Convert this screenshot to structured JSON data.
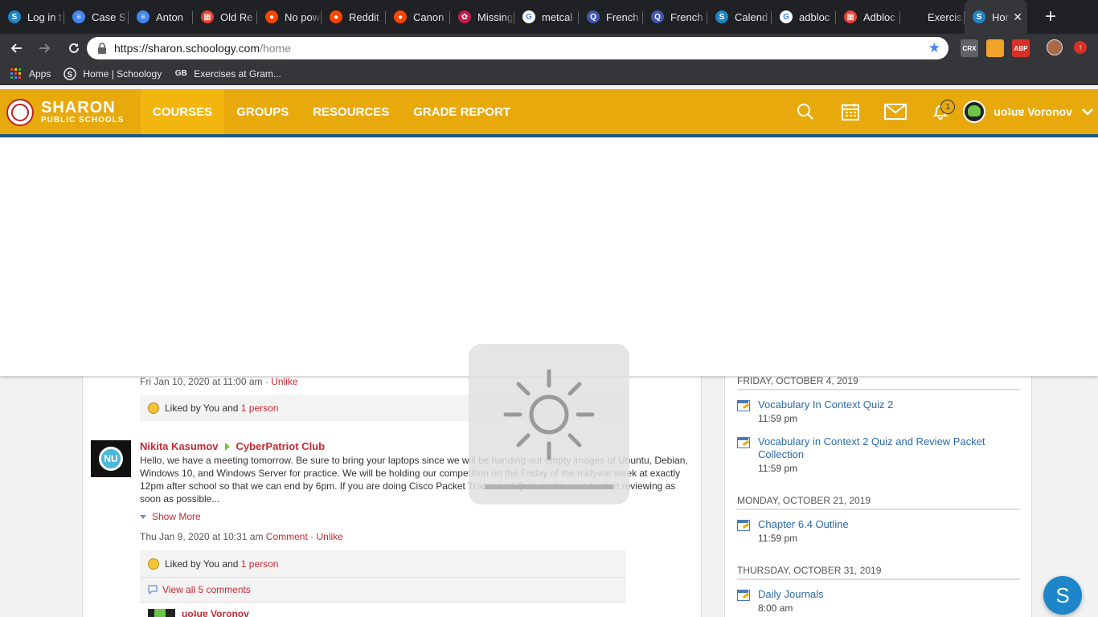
{
  "browser": {
    "tabs": [
      {
        "label": "Log in t",
        "icon": "schoology-icon",
        "color": "#1c86c8",
        "glyph": "S"
      },
      {
        "label": "Case S",
        "icon": "docs-icon",
        "color": "#4285f4",
        "glyph": "≡"
      },
      {
        "label": "Anton",
        "icon": "docs-icon",
        "color": "#4285f4",
        "glyph": "≡"
      },
      {
        "label": "Old Re",
        "icon": "store-icon",
        "color": "#e94235",
        "glyph": "▦"
      },
      {
        "label": "No pow",
        "icon": "reddit-icon",
        "color": "#ff4500",
        "glyph": "●"
      },
      {
        "label": "Reddit",
        "icon": "reddit-icon",
        "color": "#ff4500",
        "glyph": "●"
      },
      {
        "label": "Canon",
        "icon": "reddit-icon",
        "color": "#ff4500",
        "glyph": "●"
      },
      {
        "label": "Missing",
        "icon": "raspberry-icon",
        "color": "#c51a4a",
        "glyph": "✿"
      },
      {
        "label": "metcal",
        "icon": "google-icon",
        "color": "#ffffff",
        "glyph": "G"
      },
      {
        "label": "French",
        "icon": "quizlet-icon",
        "color": "#4257b2",
        "glyph": "Q"
      },
      {
        "label": "French",
        "icon": "quizlet-icon",
        "color": "#4257b2",
        "glyph": "Q"
      },
      {
        "label": "Calend",
        "icon": "schoology-icon",
        "color": "#1c86c8",
        "glyph": "S"
      },
      {
        "label": "adbloc",
        "icon": "google-icon",
        "color": "#ffffff",
        "glyph": "G"
      },
      {
        "label": "Adbloc",
        "icon": "store-icon",
        "color": "#e94235",
        "glyph": "▦"
      },
      {
        "label": "Exercis",
        "icon": "blank-icon",
        "color": "#202124",
        "glyph": ""
      },
      {
        "label": "Hor",
        "icon": "schoology-icon",
        "color": "#1c86c8",
        "glyph": "S",
        "active": true
      }
    ],
    "close_glyph": "✕",
    "new_tab_glyph": "+",
    "url_host": "https://sharon.schoology.com",
    "url_path": "/home",
    "bookmarks": [
      {
        "label": "Apps",
        "icon": "apps-grid-icon"
      },
      {
        "label": "Home | Schoology",
        "icon": "schoology-icon"
      },
      {
        "label": "Exercises at Gram...",
        "icon": "gb-icon",
        "glyph": "GB"
      }
    ],
    "extensions": [
      {
        "name": "crx-extension-icon",
        "label": "CRX",
        "color": "#5f6368"
      },
      {
        "name": "owl-extension-icon",
        "label": "",
        "color": "#f2a32a"
      },
      {
        "name": "adblock-plus-icon",
        "label": "ABP",
        "color": "#d93025"
      }
    ]
  },
  "header": {
    "logo_line1": "SHARON",
    "logo_line2": "PUBLIC SCHOOLS",
    "nav": [
      {
        "label": "COURSES",
        "active": true
      },
      {
        "label": "GROUPS"
      },
      {
        "label": "RESOURCES"
      },
      {
        "label": "GRADE REPORT"
      }
    ],
    "notification_count": "1",
    "user_name": "uoʇuɐ Voronov"
  },
  "feed": {
    "post1_meta": "Fri Jan 10, 2020 at 11:00 am",
    "post1_sep": " · ",
    "post1_unlike": "Unlike",
    "post1_liked_prefix": "Liked by You and ",
    "post1_liked_link": "1 person",
    "post2_author": "Nikita Kasumov",
    "post2_group": "CyberPatriot Club",
    "post2_body": "Hello, we have a meeting tomorrow. Be sure to bring your laptops since we will be handing out empty images of Ubuntu, Debian, Windows 10, and Windows Server for practice. We will be holding our competition on the Friday of the midyear week at exactly 12pm after school so that we can end by 6pm. If you are doing Cisco Packet Tracer and Quiz, make sure to start reviewing as soon as possible...",
    "show_more": "Show More",
    "post2_meta": "Thu Jan 9, 2020 at 10:31 am",
    "post2_comment": "Comment",
    "post2_sep": " · ",
    "post2_unlike": "Unlike",
    "post2_liked_prefix": "Liked by You and ",
    "post2_liked_link": "1 person",
    "view_comments": "View all 5 comments",
    "comment_author": "uoʇuɐ Voronov"
  },
  "upcoming": [
    {
      "date": "FRIDAY, OCTOBER 4, 2019",
      "items": [
        {
          "title": "Vocabulary In Context Quiz 2",
          "time": "11:59 pm"
        },
        {
          "title": "Vocabulary in Context 2 Quiz and Review Packet Collection",
          "time": "11:59 pm"
        }
      ]
    },
    {
      "date": "MONDAY, OCTOBER 21, 2019",
      "items": [
        {
          "title": "Chapter 6.4 Outline",
          "time": "11:59 pm"
        }
      ]
    },
    {
      "date": "THURSDAY, OCTOBER 31, 2019",
      "items": [
        {
          "title": "Daily Journals",
          "time": "8:00 am"
        }
      ]
    }
  ],
  "fab_label": "S",
  "brightness_level": 0.0,
  "colors": {
    "header": "#e8a90c",
    "header_active": "#f2b60f",
    "link_red": "#c42933",
    "link_blue": "#2b6aa8",
    "accent_bar": "#1c5a82"
  }
}
